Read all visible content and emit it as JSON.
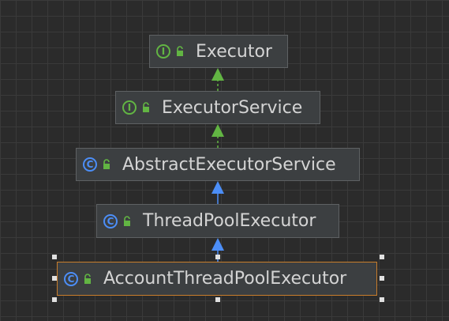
{
  "colors": {
    "background": "#2b2b2b",
    "grid": "#3a3a3a",
    "node_fill": "#3c3f41",
    "node_border": "#5e6163",
    "selected_border": "#c87d2b",
    "interface_accent": "#62b543",
    "class_accent": "#4c8ef7",
    "text": "#d4d4d4"
  },
  "nodes": [
    {
      "id": "executor",
      "label": "Executor",
      "kind": "interface",
      "kind_glyph": "I",
      "icon": "interface-icon"
    },
    {
      "id": "executor-service",
      "label": "ExecutorService",
      "kind": "interface",
      "kind_glyph": "I",
      "icon": "interface-icon"
    },
    {
      "id": "abstract-executor-service",
      "label": "AbstractExecutorService",
      "kind": "class",
      "kind_glyph": "C",
      "icon": "class-icon"
    },
    {
      "id": "thread-pool-executor",
      "label": "ThreadPoolExecutor",
      "kind": "class",
      "kind_glyph": "C",
      "icon": "class-icon"
    },
    {
      "id": "account-thread-pool-executor",
      "label": "AccountThreadPoolExecutor",
      "kind": "class",
      "kind_glyph": "C",
      "icon": "class-icon",
      "selected": true
    }
  ],
  "edges": [
    {
      "from": "executor-service",
      "to": "executor",
      "relation": "extends",
      "style": "dashed"
    },
    {
      "from": "abstract-executor-service",
      "to": "executor-service",
      "relation": "implements",
      "style": "dashed"
    },
    {
      "from": "thread-pool-executor",
      "to": "abstract-executor-service",
      "relation": "extends",
      "style": "solid"
    },
    {
      "from": "account-thread-pool-executor",
      "to": "thread-pool-executor",
      "relation": "extends",
      "style": "solid"
    }
  ]
}
